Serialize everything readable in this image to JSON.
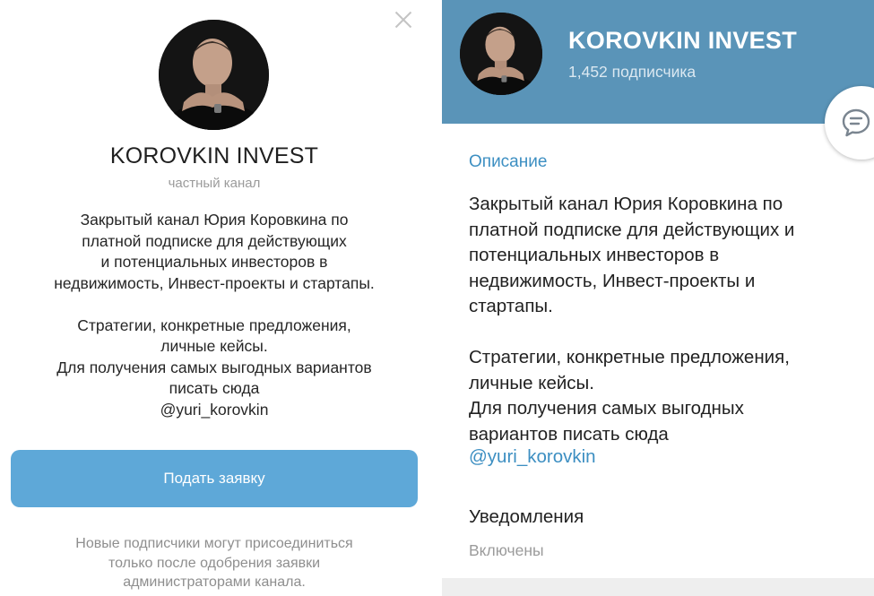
{
  "left": {
    "title": "KOROVKIN INVEST",
    "subtitle": "частный канал",
    "description": "Закрытый канал Юрия Коровкина по\nплатной подписке для действующих\nи потенциальных инвесторов в\nнедвижимость, Инвест-проекты и стартапы.\n\nСтратегии, конкретные предложения,\nличные кейсы.\nДля получения самых выгодных вариантов\nписать сюда\n@yuri_korovkin",
    "apply_button": "Подать заявку",
    "note": "Новые подписчики могут присоединиться\nтолько после одобрения заявки\nадминистраторами канала.",
    "icons": {
      "close": "close-icon",
      "avatar": "channel-avatar"
    }
  },
  "right": {
    "title": "KOROVKIN INVEST",
    "subscribers": "1,452 подписчика",
    "section_description_label": "Описание",
    "description": "Закрытый канал Юрия Коровкина по\nплатной подписке для действующих и\nпотенциальных инвесторов в\nнедвижимость, Инвест-проекты и\nстартапы.\n\nСтратегии, конкретные предложения,\nличные кейсы.\nДля получения самых выгодных\nвариантов писать сюда",
    "description_link": "@yuri_korovkin",
    "notifications_label": "Уведомления",
    "notifications_value": "Включены",
    "icons": {
      "fab": "chat-icon"
    }
  },
  "colors": {
    "header_bg": "#5a94b8",
    "button_bg": "#5ea8d8",
    "accent": "#3d8fc2",
    "muted_text": "#9b9b9b"
  }
}
